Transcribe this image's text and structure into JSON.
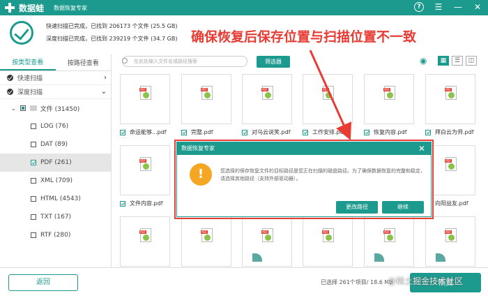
{
  "app": {
    "name": "数据蛙",
    "subtitle": "数据恢复专家"
  },
  "window": {
    "help_icon": "help-icon",
    "menu_icon": "menu-icon",
    "min_icon": "minimize-icon",
    "close_icon": "close-icon"
  },
  "status": {
    "quick": "快速扫描已完成，已找到 206173 个文件 (25.5 GB)",
    "deep": "深度扫描已完成，已找到 239219 个文件 (34.7 GB)"
  },
  "banner": "确保恢复后保存位置与扫描位置不一致",
  "sidebar": {
    "tabs": [
      "按类型查看",
      "按路径查看"
    ],
    "sections": [
      "快速扫描",
      "深度扫描"
    ],
    "tree": [
      {
        "label": "文件 (31450)",
        "state": "partial"
      },
      {
        "label": "LOG (76)",
        "state": "off"
      },
      {
        "label": "DAT (89)",
        "state": "off"
      },
      {
        "label": "PDF (261)",
        "state": "on"
      },
      {
        "label": "XML (709)",
        "state": "off"
      },
      {
        "label": "HTML (4543)",
        "state": "off"
      },
      {
        "label": "TXT (167)",
        "state": "off"
      },
      {
        "label": "RTF (280)",
        "state": "off"
      }
    ]
  },
  "toolbar": {
    "search_placeholder": "在此处输入文件名或路径搜索",
    "filter": "筛选器"
  },
  "files_row1": [
    "命运能够...pdf",
    "完整.pdf",
    "对乌云说笑.pdf",
    "工作安排.pdf",
    "恢复内容.pdf",
    "拜白云为师.pdf"
  ],
  "files_row2": [
    "文件内容.pdf",
    "向阳益友.pdf"
  ],
  "dialog": {
    "title": "数据恢复专家",
    "message": "您选择的保存恢复文件的目标路径是您正在扫描的磁盘路径。为了确保数据恢复的完整和稳定，请选择其他路径（支持外部驱动器）。",
    "change_path": "更改路径",
    "continue": "继续"
  },
  "bottom": {
    "back": "返回",
    "selection": "已选择 261个项目/ 18.6 MB",
    "recover": "恢复",
    "watermark": "@稀土掘金技术社区"
  }
}
